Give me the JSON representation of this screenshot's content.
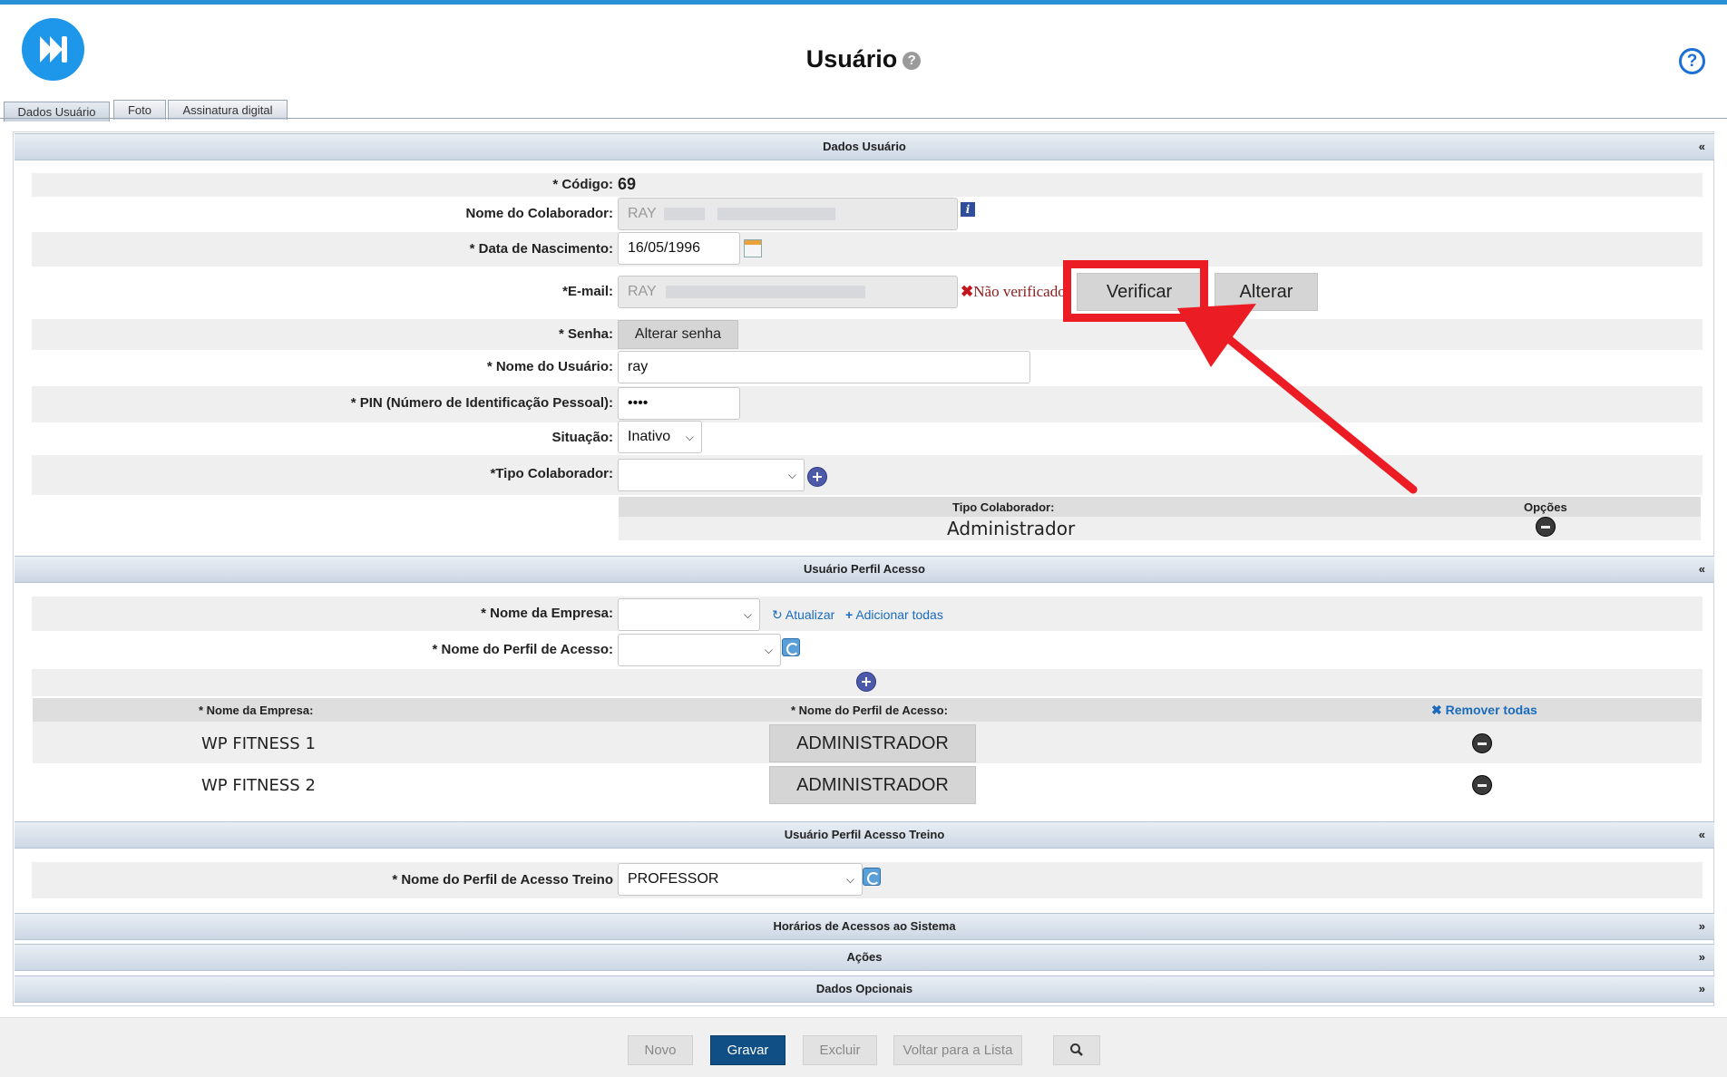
{
  "header": {
    "title": "Usuário",
    "title_help": "?",
    "help_button": "?"
  },
  "tabs": [
    {
      "label": "Dados Usuário"
    },
    {
      "label": "Foto"
    },
    {
      "label": "Assinatura digital"
    }
  ],
  "colors": {
    "accent": "#2b8fd6",
    "primary_button": "#0f4f86",
    "annotation": "#ec1c24"
  },
  "dados_usuario": {
    "header": "Dados Usuário",
    "collapse": "«",
    "codigo": {
      "label": "* Código:",
      "value": "69"
    },
    "colaborador": {
      "label": "Nome do Colaborador:",
      "value": "RAY"
    },
    "nascimento": {
      "label": "* Data de Nascimento:",
      "value": "16/05/1996"
    },
    "email": {
      "label": "*E-mail:",
      "value": "RAY",
      "status": "Não verificado",
      "status_icon": "✖",
      "verify_button": "Verificar",
      "change_button": "Alterar"
    },
    "senha": {
      "label": "* Senha:",
      "button": "Alterar senha"
    },
    "nome_usuario": {
      "label": "* Nome do Usuário:",
      "value": "ray"
    },
    "pin": {
      "label": "* PIN (Número de Identificação Pessoal):",
      "value": "••••"
    },
    "situacao": {
      "label": "Situação:",
      "value": "Inativo"
    },
    "tipo_colaborador": {
      "label": "*Tipo Colaborador:",
      "value": ""
    },
    "tipo_table": {
      "headers": [
        "Tipo Colaborador:",
        "Opções"
      ],
      "rows": [
        {
          "tipo": "Administrador"
        }
      ]
    }
  },
  "perfil_acesso": {
    "header": "Usuário Perfil Acesso",
    "collapse": "«",
    "empresa": {
      "label": "* Nome da Empresa:",
      "value": ""
    },
    "atualizar": "Atualizar",
    "adicionar_todas": "Adicionar todas",
    "perfil": {
      "label": "* Nome do Perfil de Acesso:",
      "value": ""
    },
    "table": {
      "headers": [
        "* Nome da Empresa:",
        "* Nome do Perfil de Acesso:"
      ],
      "remover_todas": "Remover todas",
      "rows": [
        {
          "empresa": "WP FITNESS 1",
          "perfil": "ADMINISTRADOR"
        },
        {
          "empresa": "WP FITNESS 2",
          "perfil": "ADMINISTRADOR"
        }
      ]
    }
  },
  "perfil_treino": {
    "header": "Usuário Perfil Acesso Treino",
    "collapse": "«",
    "perfil": {
      "label": "* Nome do Perfil de Acesso Treino",
      "value": "PROFESSOR"
    }
  },
  "collapsed_sections": [
    {
      "label": "Horários de Acessos ao Sistema",
      "expand": "»"
    },
    {
      "label": "Ações",
      "expand": "»"
    },
    {
      "label": "Dados Opcionais",
      "expand": "»"
    }
  ],
  "footer": {
    "novo": "Novo",
    "gravar": "Gravar",
    "excluir": "Excluir",
    "voltar": "Voltar para a Lista",
    "search_icon": "search-icon"
  }
}
